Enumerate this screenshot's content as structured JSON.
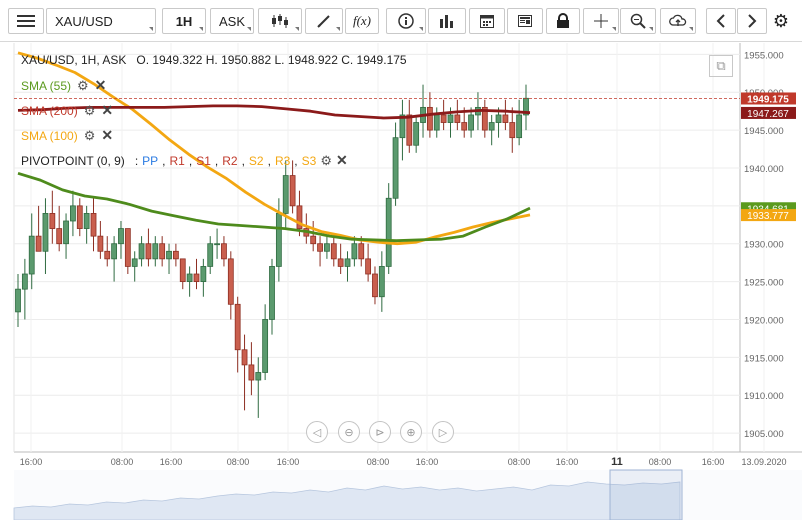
{
  "toolbar": {
    "symbol": "XAU/USD",
    "timeframe": "1H",
    "price_type": "ASK",
    "fx_label": "f(x)"
  },
  "ohlc_line": "XAU/USD, 1H, ASK   O. 1949.322 H. 1950.882 L. 1948.922 C. 1949.175",
  "indicators": [
    {
      "label": "SMA (55)",
      "color": "#5b9a1e"
    },
    {
      "label": "SMA (200)",
      "color": "#c0392b"
    },
    {
      "label": "SMA (100)",
      "color": "#f3a712"
    }
  ],
  "pivot": {
    "label": "PIVOTPOINT (0, 9)",
    "sep": ":",
    "items": [
      {
        "text": "PP",
        "color": "#2a7ae2"
      },
      {
        "text": "R1",
        "color": "#c0392b"
      },
      {
        "text": "S1",
        "color": "#c0392b"
      },
      {
        "text": "R2",
        "color": "#c0392b"
      },
      {
        "text": "S2",
        "color": "#f3a712"
      },
      {
        "text": "R3",
        "color": "#f3a712"
      },
      {
        "text": "S3",
        "color": "#f3a712"
      }
    ]
  },
  "chart_data": {
    "type": "candlestick",
    "y_ticks": [
      1955,
      1950,
      1945,
      1940,
      1935,
      1930,
      1925,
      1920,
      1915,
      1910,
      1905
    ],
    "y_tick_labels": [
      "1955.000",
      "1950.000",
      "1945.000",
      "1940.000",
      "1935.000",
      "1930.000",
      "1925.000",
      "1920.000",
      "1915.000",
      "1910.000",
      "1905.000"
    ],
    "ylim": [
      1902.5,
      1956.5
    ],
    "x_ticks": [
      "16:00",
      "08:00",
      "16:00",
      "08:00",
      "16:00",
      "08:00",
      "16:00",
      "08:00",
      "16:00",
      "11",
      "08:00",
      "16:00",
      "13.09.2020"
    ],
    "price_labels": [
      {
        "text": "1949.175",
        "value": 1949.175,
        "color": "#c0392b"
      },
      {
        "text": "1947.267",
        "value": 1947.267,
        "color": "#8b1a1a"
      },
      {
        "text": "1934.681",
        "value": 1934.681,
        "color": "#5b9a1e"
      },
      {
        "text": "1933.777",
        "value": 1933.777,
        "color": "#f3a712"
      }
    ],
    "candles": [
      [
        1921,
        1926,
        1919,
        1924
      ],
      [
        1924,
        1928,
        1920,
        1926
      ],
      [
        1926,
        1934,
        1924,
        1931
      ],
      [
        1931,
        1935,
        1929,
        1929
      ],
      [
        1929,
        1936,
        1926,
        1934
      ],
      [
        1934,
        1937,
        1930,
        1932
      ],
      [
        1932,
        1935,
        1929,
        1930
      ],
      [
        1930,
        1934,
        1928,
        1933
      ],
      [
        1933,
        1937,
        1931,
        1935
      ],
      [
        1935,
        1936,
        1931,
        1932
      ],
      [
        1932,
        1935,
        1930,
        1934
      ],
      [
        1934,
        1936,
        1929,
        1931
      ],
      [
        1931,
        1933,
        1928,
        1929
      ],
      [
        1929,
        1931,
        1927,
        1928
      ],
      [
        1928,
        1931,
        1925,
        1930
      ],
      [
        1930,
        1933,
        1928,
        1932
      ],
      [
        1932,
        1932,
        1926,
        1927
      ],
      [
        1927,
        1929,
        1925,
        1928
      ],
      [
        1928,
        1931,
        1927,
        1930
      ],
      [
        1930,
        1932,
        1927,
        1928
      ],
      [
        1928,
        1931,
        1927,
        1930
      ],
      [
        1930,
        1931,
        1927,
        1928
      ],
      [
        1928,
        1930,
        1926,
        1929
      ],
      [
        1929,
        1930,
        1927,
        1928
      ],
      [
        1928,
        1928,
        1924,
        1925
      ],
      [
        1925,
        1927,
        1923,
        1926
      ],
      [
        1926,
        1928,
        1924,
        1925
      ],
      [
        1925,
        1928,
        1923,
        1927
      ],
      [
        1927,
        1931,
        1926,
        1930
      ],
      [
        1930,
        1932,
        1928,
        1930
      ],
      [
        1930,
        1931,
        1927,
        1928
      ],
      [
        1928,
        1929,
        1920,
        1922
      ],
      [
        1922,
        1923,
        1913,
        1916
      ],
      [
        1916,
        1918,
        1908,
        1914
      ],
      [
        1914,
        1917,
        1910,
        1912
      ],
      [
        1912,
        1915,
        1907,
        1913
      ],
      [
        1913,
        1922,
        1912,
        1920
      ],
      [
        1920,
        1928,
        1918,
        1927
      ],
      [
        1927,
        1936,
        1925,
        1934
      ],
      [
        1934,
        1941,
        1932,
        1939
      ],
      [
        1939,
        1941,
        1934,
        1935
      ],
      [
        1935,
        1937,
        1931,
        1932
      ],
      [
        1932,
        1934,
        1930,
        1931
      ],
      [
        1931,
        1933,
        1929,
        1930
      ],
      [
        1930,
        1931,
        1927,
        1929
      ],
      [
        1929,
        1931,
        1928,
        1930
      ],
      [
        1930,
        1931,
        1927,
        1928
      ],
      [
        1928,
        1930,
        1926,
        1927
      ],
      [
        1927,
        1929,
        1925,
        1928
      ],
      [
        1928,
        1931,
        1927,
        1930
      ],
      [
        1930,
        1931,
        1927,
        1928
      ],
      [
        1928,
        1930,
        1925,
        1926
      ],
      [
        1926,
        1927,
        1922,
        1923
      ],
      [
        1923,
        1929,
        1921,
        1927
      ],
      [
        1927,
        1938,
        1926,
        1936
      ],
      [
        1936,
        1946,
        1935,
        1944
      ],
      [
        1944,
        1949,
        1941,
        1947
      ],
      [
        1947,
        1949,
        1942,
        1943
      ],
      [
        1943,
        1947,
        1942,
        1946
      ],
      [
        1946,
        1951,
        1944,
        1948
      ],
      [
        1948,
        1950,
        1944,
        1945
      ],
      [
        1945,
        1948,
        1944,
        1947
      ],
      [
        1947,
        1949,
        1945,
        1946
      ],
      [
        1946,
        1948,
        1944,
        1947
      ],
      [
        1947,
        1949,
        1945,
        1946
      ],
      [
        1946,
        1948,
        1944,
        1945
      ],
      [
        1945,
        1948,
        1944,
        1947
      ],
      [
        1947,
        1950,
        1945,
        1948
      ],
      [
        1948,
        1949,
        1944,
        1945
      ],
      [
        1945,
        1947,
        1943,
        1946
      ],
      [
        1946,
        1948,
        1944,
        1947
      ],
      [
        1947,
        1949,
        1945,
        1946
      ],
      [
        1946,
        1948,
        1942,
        1944
      ],
      [
        1944,
        1949,
        1943,
        1947
      ],
      [
        1947,
        1951,
        1945,
        1949.2
      ]
    ],
    "sma55": [
      1939.3,
      1938.4,
      1937.1,
      1936.3,
      1935.9,
      1935.2,
      1934.3,
      1933.7,
      1933.1,
      1932.6,
      1932.4,
      1932.2,
      1932.0,
      1931.6,
      1931.0,
      1930.6,
      1930.5,
      1930.4,
      1930.5,
      1930.6,
      1931.0,
      1932.2,
      1933.3,
      1934.7
    ],
    "sma200": [
      1947.6,
      1947.7,
      1947.9,
      1948.0,
      1948.0,
      1948.0,
      1948.0,
      1948.1,
      1948.2,
      1948.2,
      1948.1,
      1947.8,
      1947.5,
      1947.0,
      1946.8,
      1946.6,
      1946.7,
      1947.1,
      1947.4,
      1947.6,
      1947.5,
      1947.3
    ],
    "sma100": [
      1955.2,
      1954.5,
      1953.6,
      1952.6,
      1951.1,
      1949.4,
      1947.8,
      1945.8,
      1943.7,
      1941.8,
      1940.1,
      1938.6,
      1936.8,
      1935.2,
      1933.8,
      1932.5,
      1931.6,
      1931.1,
      1930.5,
      1930.2,
      1930.0,
      1930.2,
      1930.9,
      1931.5,
      1932.2,
      1932.8,
      1933.3,
      1933.8
    ]
  }
}
